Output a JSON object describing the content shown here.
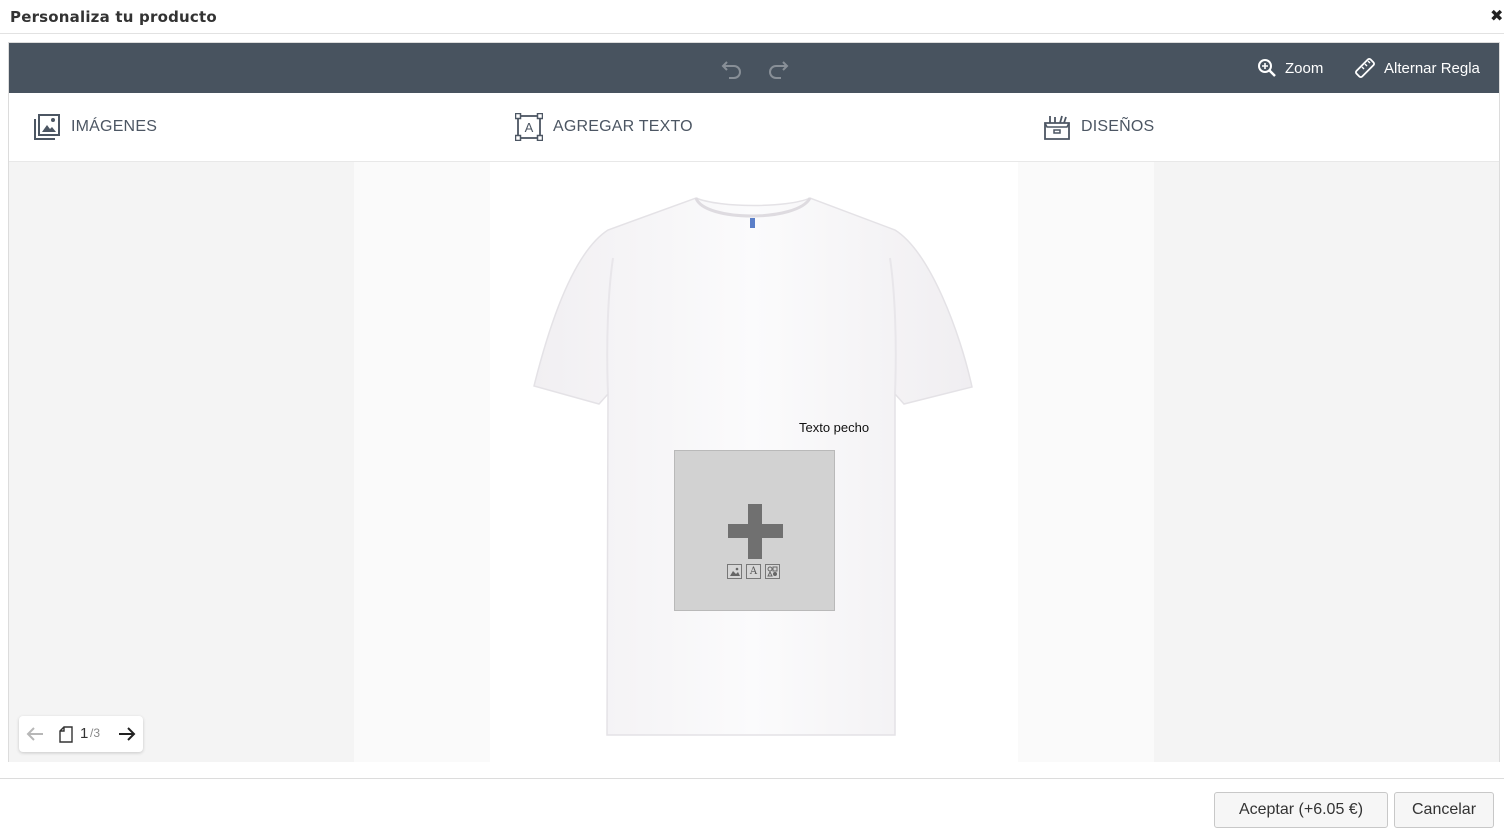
{
  "dialog": {
    "title": "Personaliza tu producto",
    "close_icon": "close-icon"
  },
  "toolbar": {
    "undo_icon": "undo-icon",
    "redo_icon": "redo-icon",
    "zoom_label": "Zoom",
    "ruler_label": "Alternar Regla"
  },
  "tabs": [
    {
      "label": "IMÁGENES",
      "icon": "images-icon"
    },
    {
      "label": "AGREGAR TEXTO",
      "icon": "add-text-icon"
    },
    {
      "label": "DISEÑOS",
      "icon": "designs-icon"
    }
  ],
  "canvas": {
    "chest_text_label": "Texto pecho",
    "drop_zone_icons": [
      "image-icon",
      "text-icon",
      "clipart-icon"
    ],
    "mini_text_glyph": "A"
  },
  "pager": {
    "current_page": "1",
    "separator_total": "/3"
  },
  "footer": {
    "accept_label": "Aceptar (+6.05 €)",
    "cancel_label": "Cancelar"
  },
  "colors": {
    "toolbar_bg": "#48535f",
    "tab_text": "#4c5663"
  }
}
